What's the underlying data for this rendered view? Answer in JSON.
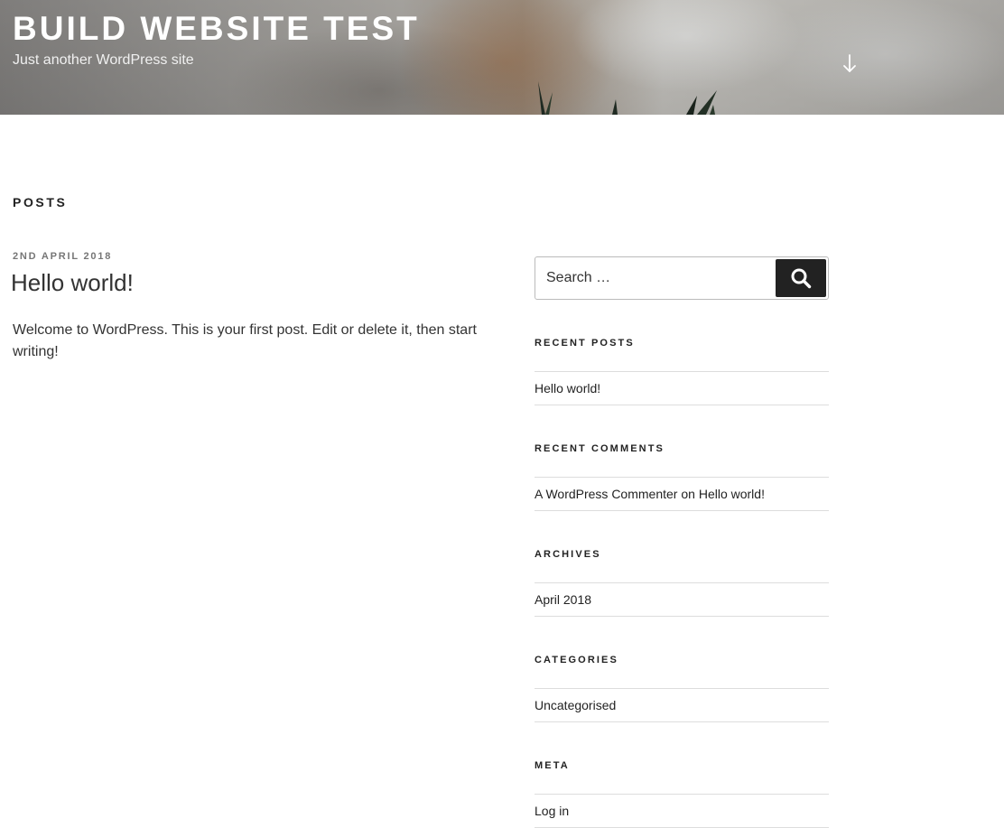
{
  "header": {
    "site_title": "BUILD WEBSITE TEST",
    "tagline": "Just another WordPress site",
    "scroll_icon": "arrow-down-icon"
  },
  "main": {
    "page_title": "POSTS",
    "posts": [
      {
        "date": "2ND APRIL 2018",
        "title": "Hello world!",
        "excerpt": "Welcome to WordPress. This is your first post. Edit or delete it, then start writing!"
      }
    ]
  },
  "sidebar": {
    "search": {
      "placeholder": "Search …",
      "button_icon": "search-icon"
    },
    "recent_posts": {
      "title": "RECENT POSTS",
      "items": [
        "Hello world!"
      ]
    },
    "recent_comments": {
      "title": "RECENT COMMENTS",
      "author": "A WordPress Commenter",
      "connector": "on",
      "post": "Hello world!"
    },
    "archives": {
      "title": "ARCHIVES",
      "items": [
        "April 2018"
      ]
    },
    "categories": {
      "title": "CATEGORIES",
      "items": [
        "Uncategorised"
      ]
    },
    "meta": {
      "title": "META",
      "items": [
        "Log in"
      ]
    }
  }
}
